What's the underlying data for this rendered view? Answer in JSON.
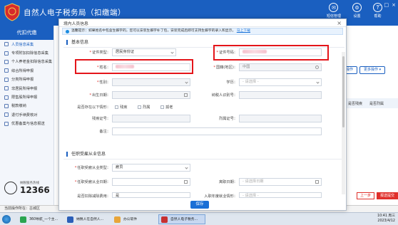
{
  "app": {
    "title": "自然人电子税务局（扣缴端）",
    "header_buttons": [
      "短信管理",
      "设置",
      "帮助"
    ],
    "window_controls": [
      "—",
      "□",
      "×"
    ]
  },
  "sidebar": {
    "title": "代扣代缴",
    "items": [
      {
        "label": "人员信息采集",
        "active": true
      },
      {
        "label": "专项附加扣除信息采集",
        "active": false
      },
      {
        "label": "个人养老金扣除信息采集",
        "active": false
      },
      {
        "label": "综合所得申报",
        "active": false
      },
      {
        "label": "分类所得申报",
        "active": false
      },
      {
        "label": "非居民所得申报",
        "active": false
      },
      {
        "label": "限售股所得申报",
        "active": false
      },
      {
        "label": "税款缴纳",
        "active": false
      },
      {
        "label": "退付手续费核对",
        "active": false
      },
      {
        "label": "优惠备案与信息报送",
        "active": false
      }
    ],
    "hotline_label": "纳税服务热线",
    "hotline_number": "12366"
  },
  "status_bar": {
    "text": "当前操作所在：古城区"
  },
  "background": {
    "buttons": [
      "操作",
      "更多操作 ▾"
    ],
    "table_headers": [
      "是否残疾",
      "是否烈属"
    ],
    "bottom_buttons": [
      "上一步",
      "报送提交"
    ]
  },
  "taskbar": {
    "tasks": [
      {
        "label": "360导航_一个主...",
        "active": false,
        "color": "#2aa44f"
      },
      {
        "label": "纳税人在自然人...",
        "active": false,
        "color": "#2b5fb8"
      },
      {
        "label": "办公软件",
        "active": false,
        "color": "#e8a53a"
      },
      {
        "label": "自然人电子税务...",
        "active": true,
        "color": "#c73030"
      }
    ],
    "time": "10:41 周三",
    "date": "2023/4/12"
  },
  "modal": {
    "title": "境内人员信息",
    "close": "×",
    "notice": "温馨提示：如果姓名中包含生僻字的，您可以安装生僻字补丁包，安装完成后即可支持生僻字的录入和显示。",
    "notice_link": "马上下载",
    "section_basic": "基本信息",
    "section_job": "任职受雇从业信息",
    "save_label": "保存",
    "fields": {
      "id_type": {
        "label": "证件类型：",
        "value": "居民身份证"
      },
      "id_number": {
        "label": "证件号码：",
        "value": ""
      },
      "name": {
        "label": "姓名：",
        "value": ""
      },
      "country": {
        "label": "国籍(地区)：",
        "value": "中国"
      },
      "gender": {
        "label": "性别：",
        "value": ""
      },
      "education": {
        "label": "学历：",
        "placeholder": "- 请选择 -"
      },
      "birth_date": {
        "label": "出生日期：",
        "value": ""
      },
      "taxpayer_id": {
        "label": "纳税人识别号：",
        "value": ""
      },
      "special_status": {
        "label": "是否存在以下情形：",
        "options": [
          "残疾",
          "烈属",
          "孤老"
        ]
      },
      "disability_cert": {
        "label": "残疾证号：",
        "value": ""
      },
      "martyr_cert": {
        "label": "烈属证号：",
        "value": ""
      },
      "remark": {
        "label": "备注：",
        "value": ""
      },
      "employment_type": {
        "label": "任职受雇从业类型：",
        "value": "雇员"
      },
      "employment_date": {
        "label": "任职受雇从业日期：",
        "value": ""
      },
      "leave_date": {
        "label": "离职日期：",
        "placeholder": "- 请选择日期"
      },
      "deduct_fee": {
        "label": "是否扣除减除费用：",
        "value": "是"
      },
      "entry_situation": {
        "label": "入职年度就业情形：",
        "placeholder": "- 请选择 -"
      }
    }
  }
}
